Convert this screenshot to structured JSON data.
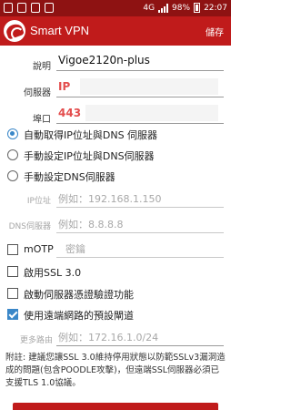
{
  "status_bar": {
    "time": "22:07",
    "battery": "98%",
    "network": "4G"
  },
  "action_bar": {
    "title": "Smart VPN",
    "save_label": "儲存"
  },
  "form": {
    "description": {
      "label": "說明",
      "value": "Vigoe2120n-plus"
    },
    "server": {
      "label": "伺服器",
      "value": "IP"
    },
    "port": {
      "label": "埠口",
      "value": "443"
    }
  },
  "ip_mode": {
    "options": [
      {
        "label": "自動取得IP位址與DNS 伺服器",
        "selected": true
      },
      {
        "label": "手動設定IP位址與DNS伺服器",
        "selected": false
      },
      {
        "label": "手動設定DNS伺服器",
        "selected": false
      }
    ]
  },
  "ip_address": {
    "label": "IP位址",
    "placeholder": "例如：192.168.1.150"
  },
  "dns_server": {
    "label": "DNS伺服器",
    "placeholder": "例如：8.8.8.8"
  },
  "motp": {
    "label": "mOTP",
    "placeholder": "密鑰",
    "checked": false
  },
  "ssl3": {
    "label": "啟用SSL 3.0",
    "checked": false
  },
  "verify_cert": {
    "label": "啟動伺服器憑證驗證功能",
    "checked": false
  },
  "default_gateway": {
    "label": "使用遠端網路的預設閘道",
    "checked": true
  },
  "routes": {
    "label": "更多路由",
    "placeholder": "例如：172.16.1.0/24"
  },
  "note": "附註: 建議您讓SSL 3.0維持停用狀態以防範SSLv3漏洞造成的問題(包含POODLE攻擊)，但遠端SSL伺服器必須已支援TLS 1.0協議。",
  "colors": {
    "accent": "#c01b1b",
    "status": "#8e1212",
    "control": "#3a87c8"
  }
}
